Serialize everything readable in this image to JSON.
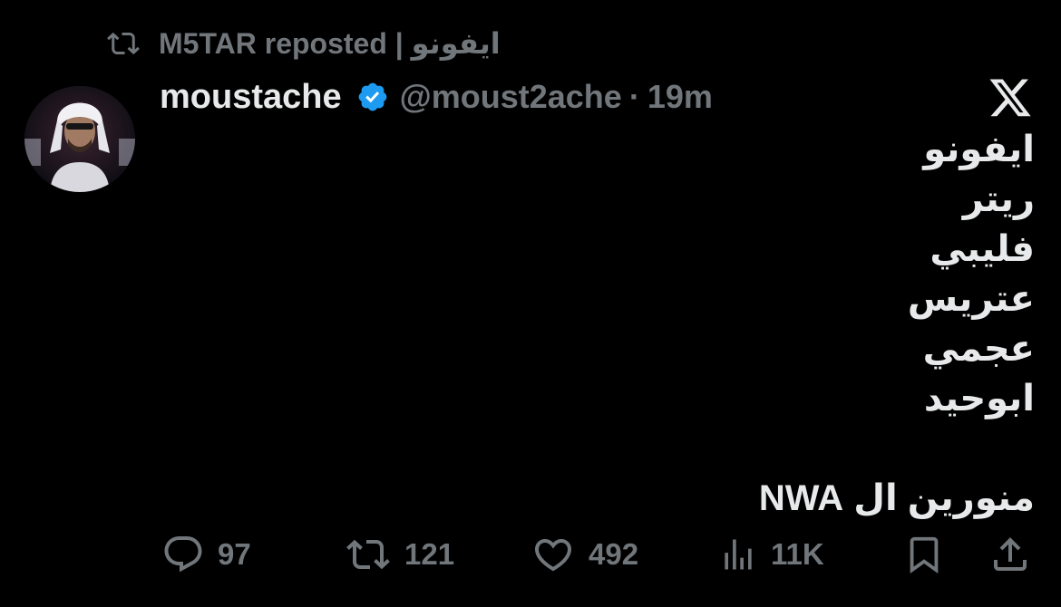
{
  "repost": {
    "icon": "repost-icon",
    "text": "M5TAR reposted | ايفونو"
  },
  "author": {
    "display_name": "moustache",
    "verified_icon": "verified-badge-icon",
    "handle": "@moust2ache",
    "separator": "·",
    "time": "19m"
  },
  "brand": {
    "logo": "x-logo-icon"
  },
  "tweet": {
    "lines": [
      "ايفونو",
      "ريتر",
      "فليبي",
      "عتريس",
      "عجمي",
      "ابوحيد"
    ],
    "closing": "منورين ال NWA"
  },
  "actions": {
    "replies": {
      "icon": "reply-icon",
      "count": "97"
    },
    "reposts": {
      "icon": "repost-icon",
      "count": "121"
    },
    "likes": {
      "icon": "heart-icon",
      "count": "492"
    },
    "views": {
      "icon": "views-icon",
      "count": "11K"
    },
    "bookmark": {
      "icon": "bookmark-icon"
    },
    "share": {
      "icon": "share-icon"
    }
  },
  "colors": {
    "background": "#000000",
    "text": "#e7e9ea",
    "muted": "#71767b",
    "verified": "#1d9bf0"
  }
}
